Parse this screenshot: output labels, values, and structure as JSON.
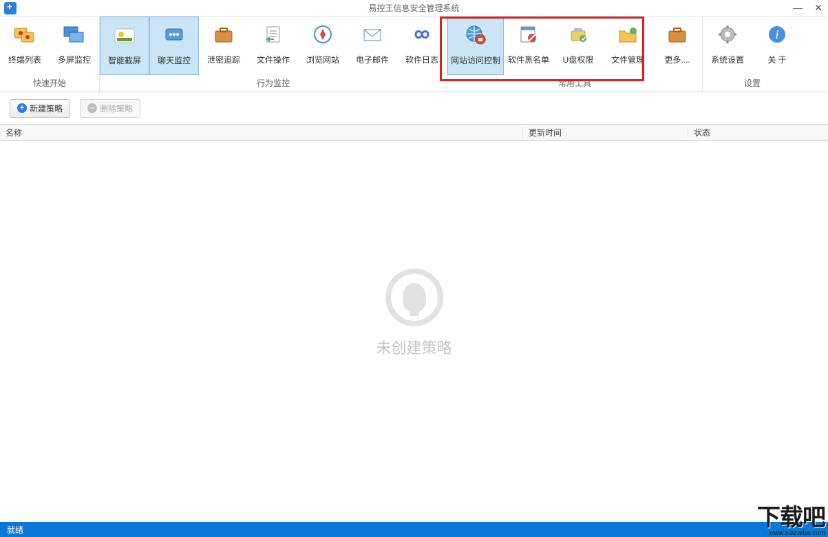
{
  "window": {
    "title": "易控王信息安全管理系统"
  },
  "ribbon": {
    "groups": [
      {
        "label": "快速开始",
        "items": [
          {
            "label": "终端列表",
            "icon": "terminal-list"
          },
          {
            "label": "多屏监控",
            "icon": "multi-screen"
          }
        ]
      },
      {
        "label": "行为监控",
        "items": [
          {
            "label": "智能截屏",
            "icon": "screenshot",
            "selected": true
          },
          {
            "label": "聊天监控",
            "icon": "chat",
            "selected": true
          },
          {
            "label": "泄密追踪",
            "icon": "briefcase"
          },
          {
            "label": "文件操作",
            "icon": "file-op"
          },
          {
            "label": "浏览网站",
            "icon": "compass"
          },
          {
            "label": "电子邮件",
            "icon": "mail"
          },
          {
            "label": "软件日志",
            "icon": "infinity"
          }
        ]
      },
      {
        "label": "常用工具",
        "items": [
          {
            "label": "网站访问控制",
            "icon": "globe-lock",
            "selected": true
          },
          {
            "label": "软件黑名单",
            "icon": "blacklist"
          },
          {
            "label": "U盘权限",
            "icon": "usb"
          },
          {
            "label": "文件管理",
            "icon": "folder"
          },
          {
            "label": "更多....",
            "icon": "briefcase2"
          }
        ]
      },
      {
        "label": "设置",
        "items": [
          {
            "label": "系统设置",
            "icon": "gear"
          },
          {
            "label": "关 于",
            "icon": "info"
          }
        ]
      }
    ]
  },
  "actions": {
    "new_policy": "新建策略",
    "delete_policy": "删除策略"
  },
  "table": {
    "columns": {
      "name": "名称",
      "update": "更新时间",
      "status": "状态"
    }
  },
  "empty": {
    "text": "未创建策略"
  },
  "statusbar": {
    "text": "就绪"
  },
  "watermark": {
    "brand": "下载吧",
    "url": "www.xiazaiba.com"
  }
}
